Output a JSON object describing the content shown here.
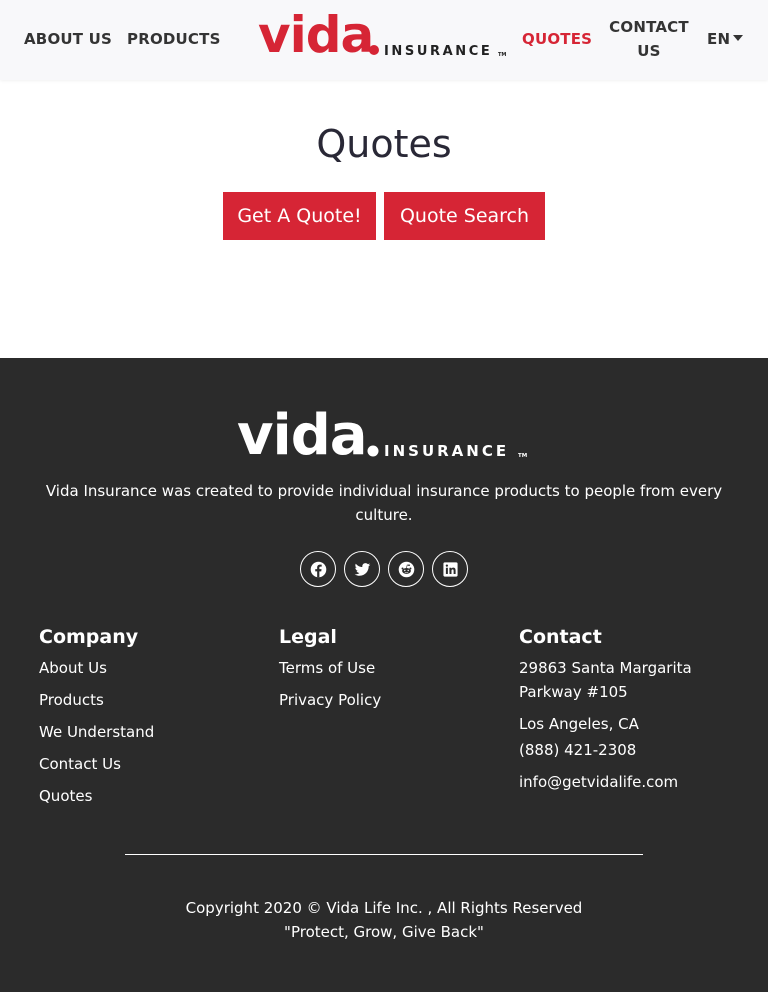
{
  "nav": {
    "about": "ABOUT US",
    "products": "PRODUCTS",
    "quotes": "QUOTES",
    "contact": "CONTACT US",
    "language": "EN"
  },
  "logo": {
    "word": "vida",
    "sub": "INSURANCE",
    "tm": "TM"
  },
  "main": {
    "title": "Quotes",
    "get_quote_label": "Get A Quote!",
    "quote_search_label": "Quote Search"
  },
  "footer": {
    "tagline": "Vida Insurance was created to provide individual insurance products to people from every culture.",
    "social_icons": [
      "facebook-icon",
      "twitter-icon",
      "reddit-icon",
      "linkedin-icon"
    ],
    "company": {
      "heading": "Company",
      "links": [
        "About Us",
        "Products",
        "We Understand",
        "Contact Us",
        "Quotes"
      ]
    },
    "legal": {
      "heading": "Legal",
      "links": [
        "Terms of Use",
        "Privacy Policy"
      ]
    },
    "contact": {
      "heading": "Contact",
      "address1": "29863 Santa Margarita Parkway #105",
      "address2": "Los Angeles, CA",
      "phone": "(888) 421-2308",
      "email": "info@getvidalife.com"
    },
    "copyright": "Copyright 2020 © Vida Life Inc. , All Rights Reserved",
    "motto": "\"Protect, Grow, Give Back\""
  },
  "colors": {
    "brand_red": "#d62535",
    "footer_bg": "#2b2b2b",
    "nav_bg": "#f8f8fa",
    "text_dark": "#292836"
  }
}
